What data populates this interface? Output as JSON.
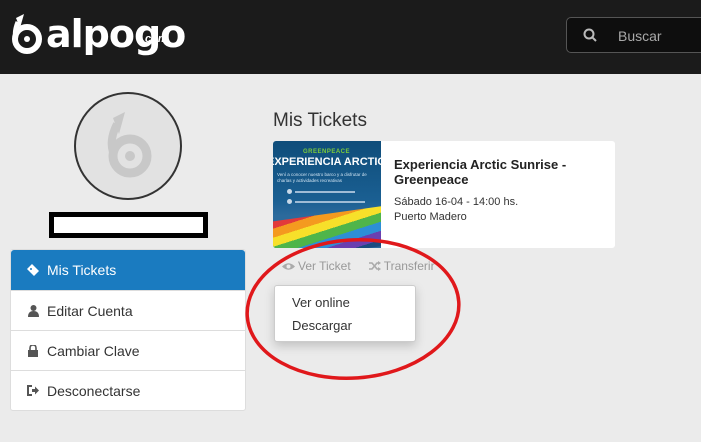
{
  "header": {
    "logo_text": "alpogo",
    "logo_suffix": ".com",
    "search": {
      "placeholder": "Buscar"
    }
  },
  "sidebar": {
    "items": [
      {
        "label": "Mis Tickets",
        "icon": "ticket-icon"
      },
      {
        "label": "Editar Cuenta",
        "icon": "user-icon"
      },
      {
        "label": "Cambiar Clave",
        "icon": "lock-icon"
      },
      {
        "label": "Desconectarse",
        "icon": "sign-out-icon"
      }
    ]
  },
  "main": {
    "title": "Mis Tickets",
    "ticket": {
      "event_title": "Experiencia Arctic Sunrise - Greenpeace",
      "date": "Sábado 16-04 - 14:00 hs.",
      "place": "Puerto Madero",
      "image_brand": "GREENPEACE",
      "image_title": "EXPERIENCIA ARCTIC SUNRISE",
      "image_subtitle": "Vení a conocer nuestro barco y a disfrutar de charlas y actividades recreativas"
    },
    "actions": {
      "view_label": "Ver Ticket",
      "transfer_label": "Transferir"
    },
    "dropdown": {
      "items": [
        "Ver online",
        "Descargar"
      ]
    }
  },
  "colors": {
    "header_bg": "#1b1b1b",
    "accent": "#1a7bc0",
    "annotation": "#e0181b"
  }
}
